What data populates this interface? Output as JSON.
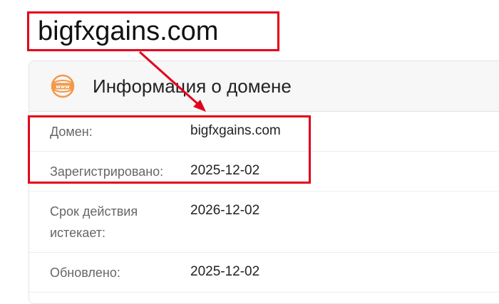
{
  "annotation": {
    "domain_label": "bigfxgains.com",
    "accent_color": "#e3001b"
  },
  "card": {
    "icon": "www-icon",
    "title": "Информация о домене",
    "rows": [
      {
        "label": "Домен:",
        "value": "bigfxgains.com"
      },
      {
        "label": "Зарегистрировано:",
        "value": "2025-12-02"
      },
      {
        "label": "Срок действия истекает:",
        "label_lines": [
          "Срок действия",
          "истекает:"
        ],
        "value": "2026-12-02"
      },
      {
        "label": "Обновлено:",
        "value": "2025-12-02"
      }
    ]
  }
}
